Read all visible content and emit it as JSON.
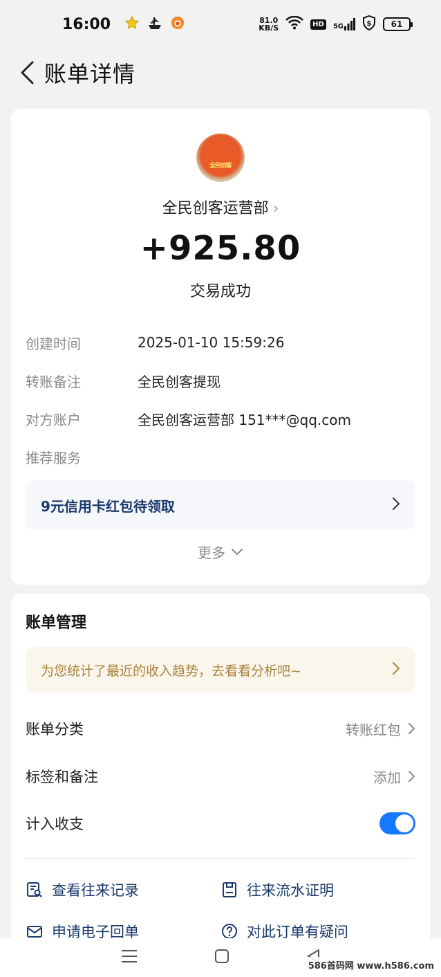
{
  "status_bar": {
    "time": "16:00",
    "net_speed_value": "81.0",
    "net_speed_unit": "KB/S",
    "hd_label": "HD",
    "signal_label": "5G",
    "battery": "61"
  },
  "header": {
    "title": "账单详情"
  },
  "transaction": {
    "merchant_logo_text": "全民创客",
    "merchant_name": "全民创客运营部",
    "amount": "+925.80",
    "status": "交易成功",
    "details": [
      {
        "label": "创建时间",
        "value": "2025-01-10 15:59:26"
      },
      {
        "label": "转账备注",
        "value": "全民创客提现"
      },
      {
        "label": "对方账户",
        "value": "全民创客运营部 151***@qq.com"
      },
      {
        "label": "推荐服务",
        "value": ""
      }
    ],
    "promo_text": "9元信用卡红包待领取",
    "more_label": "更多"
  },
  "manage": {
    "title": "账单管理",
    "trend_banner": "为您统计了最近的收入趋势，去看看分析吧~",
    "category_label": "账单分类",
    "category_value": "转账红包",
    "tag_label": "标签和备注",
    "tag_value": "添加",
    "income_label": "计入收支",
    "income_enabled": true,
    "actions": [
      {
        "label": "查看往来记录",
        "icon": "search-record-icon"
      },
      {
        "label": "往来流水证明",
        "icon": "document-proof-icon"
      },
      {
        "label": "申请电子回单",
        "icon": "mail-icon"
      },
      {
        "label": "对此订单有疑问",
        "icon": "question-icon"
      }
    ]
  },
  "watermark": "586首码网 www.h586.com",
  "colors": {
    "accent_blue": "#1677ff",
    "link_navy": "#1a3a6b",
    "trend_gold": "#a9823c",
    "background": "#f2f2f2"
  }
}
